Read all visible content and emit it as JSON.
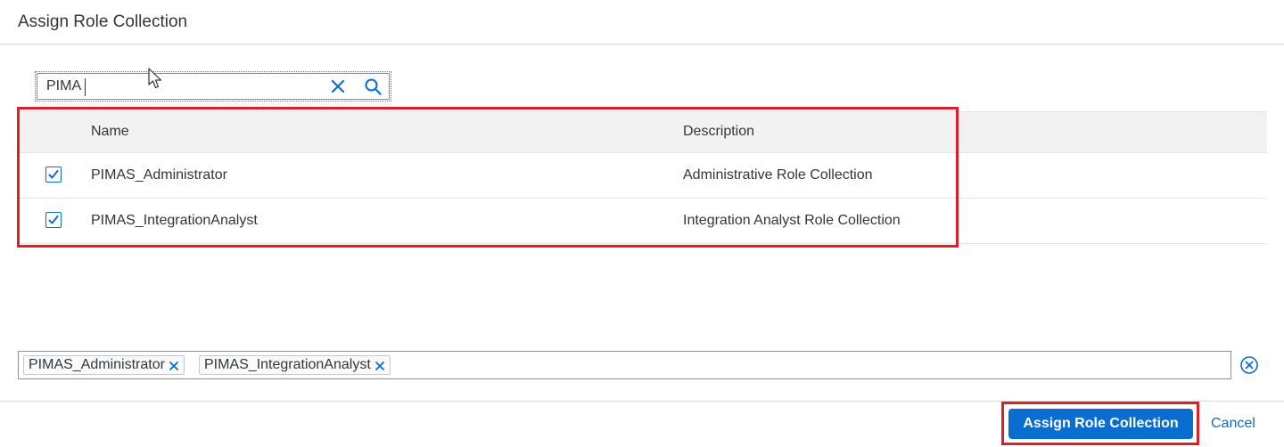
{
  "dialog": {
    "title": "Assign Role Collection"
  },
  "search": {
    "value": "PIMA",
    "clear_icon": "close-icon",
    "search_icon": "magnifier-icon"
  },
  "table": {
    "columns": [
      "Name",
      "Description"
    ],
    "rows": [
      {
        "checked": true,
        "name": "PIMAS_Administrator",
        "description": "Administrative Role Collection"
      },
      {
        "checked": true,
        "name": "PIMAS_IntegrationAnalyst",
        "description": "Integration Analyst Role Collection"
      }
    ]
  },
  "selected_tokens": [
    "PIMAS_Administrator",
    "PIMAS_IntegrationAnalyst"
  ],
  "footer": {
    "assign_label": "Assign Role Collection",
    "cancel_label": "Cancel"
  },
  "colors": {
    "accent": "#0a6ed1",
    "highlight": "#e01e26",
    "header_bg": "#f2f2f2"
  }
}
